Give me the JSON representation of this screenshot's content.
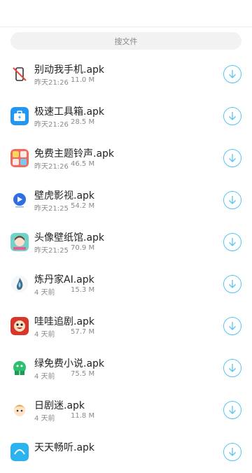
{
  "search": {
    "placeholder": "搜文件"
  },
  "files": [
    {
      "name": "别动我手机.apk",
      "time": "昨天21:26",
      "size": "11.0 M",
      "icon": "phone-no-touch-icon"
    },
    {
      "name": "极速工具箱.apk",
      "time": "昨天21:26",
      "size": "28.5 M",
      "icon": "toolbox-icon"
    },
    {
      "name": "免费主题铃声.apk",
      "time": "昨天21:26",
      "size": "46.5 M",
      "icon": "theme-ringtone-icon"
    },
    {
      "name": "壁虎影视.apk",
      "time": "昨天21:25",
      "size": "54.2 M",
      "icon": "video-icon"
    },
    {
      "name": "头像壁纸馆.apk",
      "time": "昨天21:25",
      "size": "70.9 M",
      "icon": "avatar-wallpaper-icon"
    },
    {
      "name": "炼丹家AI.apk",
      "time": "4 天前",
      "size": "15.3 M",
      "icon": "alchemist-ai-icon"
    },
    {
      "name": "哇哇追剧.apk",
      "time": "4 天前",
      "size": "57.7 M",
      "icon": "drama-icon"
    },
    {
      "name": "绿免费小说.apk",
      "time": "4 天前",
      "size": "75.5 M",
      "icon": "novel-icon"
    },
    {
      "name": "日剧迷.apk",
      "time": "4 天前",
      "size": "11.8 M",
      "icon": "jdrama-icon"
    },
    {
      "name": "天天畅听.apk",
      "time": "",
      "size": "",
      "icon": "listen-icon"
    }
  ],
  "colors": {
    "accent": "#55c6ef",
    "text": "#222222",
    "meta": "#8a8a8a",
    "search_bg": "#f2f2f2"
  }
}
